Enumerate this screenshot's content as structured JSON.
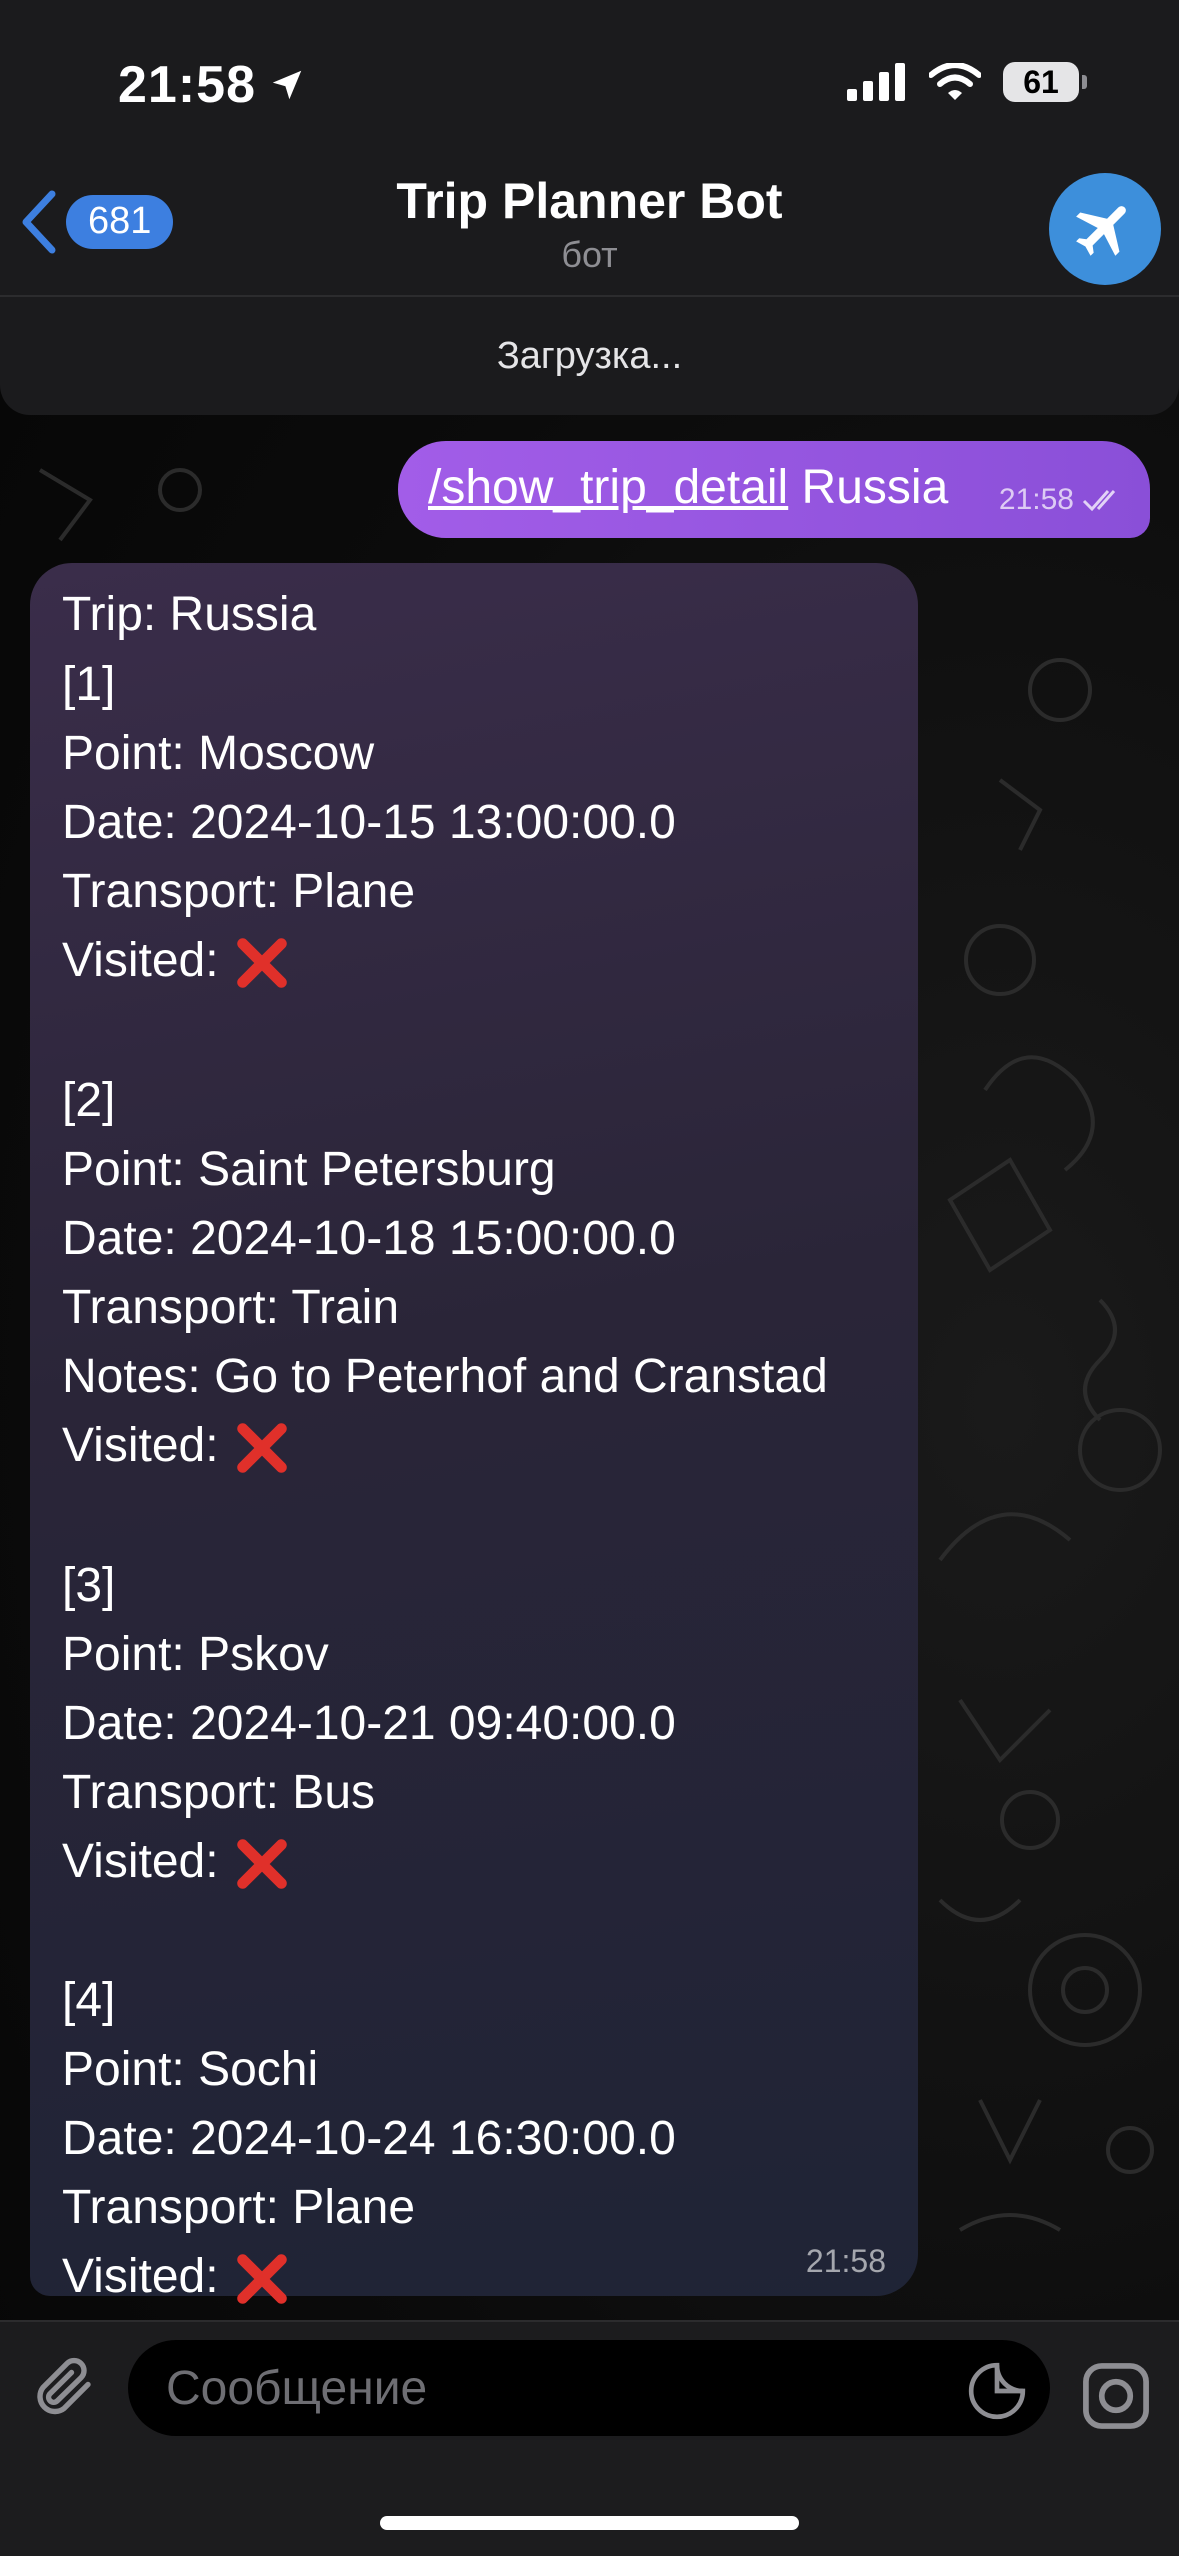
{
  "status_bar": {
    "time": "21:58",
    "battery": "61"
  },
  "header": {
    "back_count": "681",
    "title": "Trip Planner Bot",
    "subtitle": "бот",
    "loading": "Загрузка..."
  },
  "outgoing": {
    "command": "/show_trip_detail",
    "argument": " Russia",
    "time": "21:58"
  },
  "incoming": {
    "time": "21:58",
    "lines": [
      {
        "text": "Trip: Russia",
        "cross": false
      },
      {
        "text": "[1]",
        "cross": false
      },
      {
        "text": "Point: Moscow",
        "cross": false
      },
      {
        "text": "Date: 2024-10-15 13:00:00.0",
        "cross": false
      },
      {
        "text": "Transport: Plane",
        "cross": false
      },
      {
        "text": "Visited:",
        "cross": true
      },
      {
        "text": "[2]",
        "cross": false
      },
      {
        "text": "Point: Saint Petersburg",
        "cross": false
      },
      {
        "text": "Date: 2024-10-18 15:00:00.0",
        "cross": false
      },
      {
        "text": "Transport: Train",
        "cross": false
      },
      {
        "text": "Notes: Go to Peterhof and Cranstad",
        "cross": false
      },
      {
        "text": "Visited:",
        "cross": true
      },
      {
        "text": "[3]",
        "cross": false
      },
      {
        "text": "Point: Pskov",
        "cross": false
      },
      {
        "text": "Date: 2024-10-21 09:40:00.0",
        "cross": false
      },
      {
        "text": "Transport: Bus",
        "cross": false
      },
      {
        "text": "Visited:",
        "cross": true
      },
      {
        "text": "[4]",
        "cross": false
      },
      {
        "text": "Point: Sochi",
        "cross": false
      },
      {
        "text": "Date: 2024-10-24 16:30:00.0",
        "cross": false
      },
      {
        "text": "Transport: Plane",
        "cross": false
      },
      {
        "text": "Visited:",
        "cross": true
      }
    ]
  },
  "composer": {
    "placeholder": "Сообщение"
  },
  "colors": {
    "accent": "#3d7fe0",
    "outgoing_bubble": "#9a58e4",
    "cross": "#e0302a"
  },
  "icons": [
    "location-arrow-icon",
    "signal-icon",
    "wifi-icon",
    "back-chevron-icon",
    "airplane-icon",
    "double-check-icon",
    "cross-mark-icon",
    "paperclip-icon",
    "sticker-icon",
    "camera-icon"
  ]
}
